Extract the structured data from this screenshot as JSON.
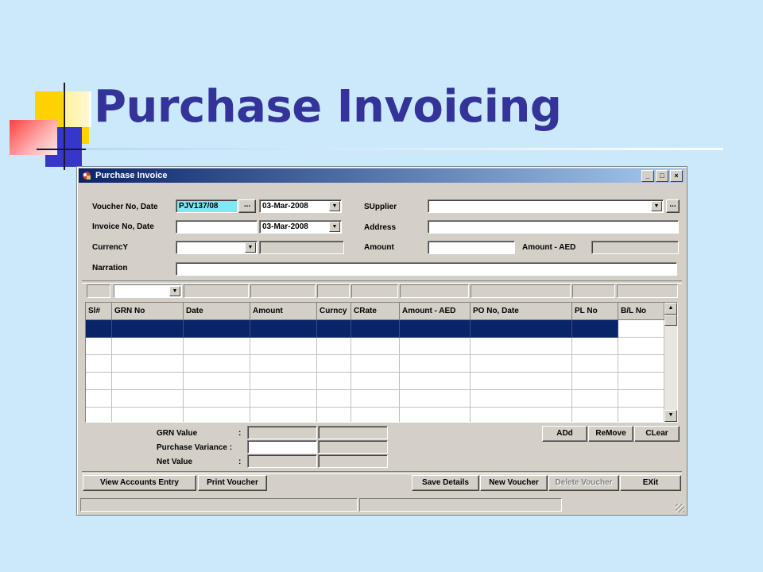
{
  "slide": {
    "title": "Purchase Invoicing"
  },
  "window": {
    "title": "Purchase Invoice",
    "controls": {
      "minimize": "_",
      "maximize": "□",
      "close": "×"
    }
  },
  "form": {
    "voucher_label": "Voucher No, Date",
    "voucher_no": "PJV137/08",
    "voucher_date": "03-Mar-2008",
    "invoice_label": "Invoice No, Date",
    "invoice_no": "",
    "invoice_date": "03-Mar-2008",
    "currency_label": "CurrencY",
    "currency_value": "",
    "narration_label": "Narration",
    "narration_value": "",
    "supplier_label": "SUpplier",
    "supplier_value": "",
    "address_label": "Address",
    "address_value": "",
    "amount_label": "Amount",
    "amount_value": "",
    "amount_aed_label": "Amount - AED",
    "amount_aed_value": "",
    "ellipsis": "..."
  },
  "grid": {
    "columns": [
      "Sl#",
      "GRN No",
      "Date",
      "Amount",
      "Curncy",
      "CRate",
      "Amount - AED",
      "PO No, Date",
      "PL No",
      "B/L No"
    ],
    "rows": [
      {
        "selected": true,
        "cells": [
          "",
          "",
          "",
          "",
          "",
          "",
          "",
          "",
          "",
          ""
        ]
      },
      {
        "selected": false,
        "cells": [
          "",
          "",
          "",
          "",
          "",
          "",
          "",
          "",
          "",
          ""
        ]
      },
      {
        "selected": false,
        "cells": [
          "",
          "",
          "",
          "",
          "",
          "",
          "",
          "",
          "",
          ""
        ]
      },
      {
        "selected": false,
        "cells": [
          "",
          "",
          "",
          "",
          "",
          "",
          "",
          "",
          "",
          ""
        ]
      },
      {
        "selected": false,
        "cells": [
          "",
          "",
          "",
          "",
          "",
          "",
          "",
          "",
          "",
          ""
        ]
      },
      {
        "selected": false,
        "cells": [
          "",
          "",
          "",
          "",
          "",
          "",
          "",
          "",
          "",
          ""
        ]
      }
    ]
  },
  "summary": {
    "grn_value_label": "GRN Value",
    "purchase_variance_label": "Purchase Variance :",
    "net_value_label": "Net Value",
    "colon": ":"
  },
  "buttons": {
    "add": "ADd",
    "remove": "ReMove",
    "clear": "CLear",
    "view_accounts": "View Accounts Entry",
    "print_voucher": "Print Voucher",
    "save_details": "Save Details",
    "new_voucher": "New Voucher",
    "delete_voucher": "Delete Voucher",
    "exit": "EXit"
  }
}
